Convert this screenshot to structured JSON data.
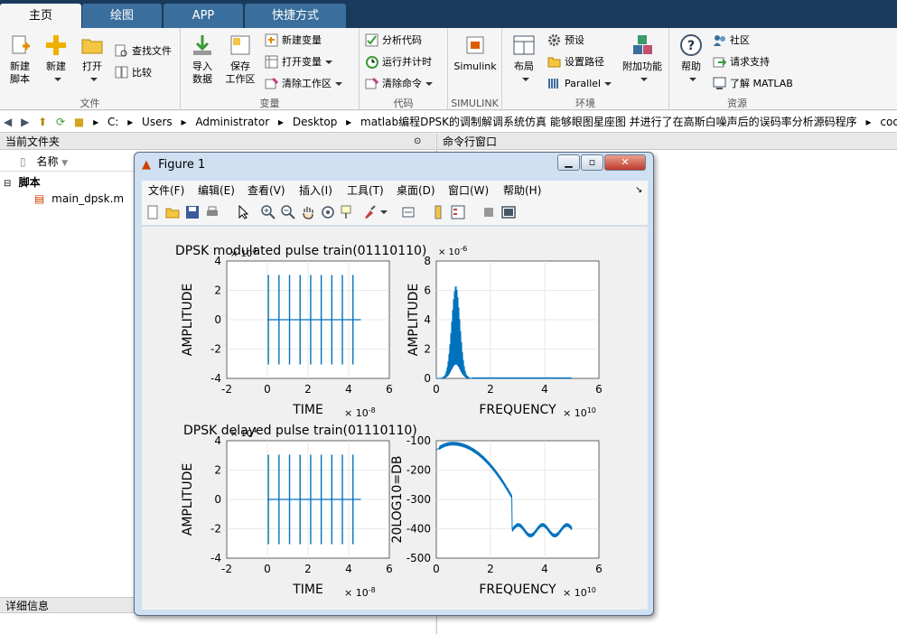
{
  "tabs": [
    "主页",
    "绘图",
    "APP",
    "快捷方式"
  ],
  "ribbon": {
    "file": {
      "label": "文件",
      "new_script": "新建\n脚本",
      "new": "新建",
      "open": "打开",
      "find_files": "查找文件",
      "compare": "比较"
    },
    "variable": {
      "label": "变量",
      "import": "导入\n数据",
      "save_workspace": "保存\n工作区",
      "new_variable": "新建变量",
      "open_variable": "打开变量",
      "clear_workspace": "清除工作区"
    },
    "code": {
      "label": "代码",
      "analyze": "分析代码",
      "run_time": "运行并计时",
      "clear_commands": "清除命令"
    },
    "simulink": {
      "label": "SIMULINK",
      "simulink": "Simulink"
    },
    "environment": {
      "label": "环境",
      "layout": "布局",
      "preferences": "预设",
      "set_path": "设置路径",
      "parallel": "Parallel",
      "addons": "附加功能"
    },
    "resources": {
      "label": "资源",
      "help": "帮助",
      "community": "社区",
      "support": "请求支持",
      "learn": "了解 MATLAB"
    }
  },
  "address": [
    "C:",
    "Users",
    "Administrator",
    "Desktop",
    "matlab编程DPSK的调制解调系统仿真 能够眼图星座图 并进行了在高斯白噪声后的误码率分析源码程序",
    "code"
  ],
  "file_browser": {
    "title": "当前文件夹",
    "column": "名称",
    "group": "脚本",
    "file": "main_dpsk.m",
    "details": "详细信息"
  },
  "command_window": {
    "title": "命令行窗口"
  },
  "figure": {
    "title": "Figure 1",
    "menu": [
      "文件(F)",
      "编辑(E)",
      "查看(V)",
      "插入(I)",
      "工具(T)",
      "桌面(D)",
      "窗口(W)",
      "帮助(H)"
    ],
    "plots": [
      {
        "title": "DPSK modulated pulse train(01110110)",
        "xlabel": "TIME",
        "ylabel": "AMPLITUDE",
        "xticks": [
          "-2",
          "0",
          "2",
          "4",
          "6"
        ],
        "yticks": [
          "4",
          "2",
          "0",
          "-2",
          "-4"
        ],
        "xexp": "× 10",
        "xexp_power": "-8",
        "yexp": "× 10",
        "yexp_power": "4"
      },
      {
        "title": "",
        "xlabel": "FREQUENCY",
        "ylabel": "AMPLITUDE",
        "xticks": [
          "0",
          "2",
          "4",
          "6"
        ],
        "yticks": [
          "8",
          "6",
          "4",
          "2",
          "0"
        ],
        "xexp": "× 10",
        "xexp_power": "10",
        "yexp": "× 10",
        "yexp_power": "-6"
      },
      {
        "title": "DPSK delayed pulse train(01110110)",
        "xlabel": "TIME",
        "ylabel": "AMPLITUDE",
        "xticks": [
          "-2",
          "0",
          "2",
          "4",
          "6"
        ],
        "yticks": [
          "4",
          "2",
          "0",
          "-2",
          "-4"
        ],
        "xexp": "× 10",
        "xexp_power": "-8",
        "yexp": "× 10",
        "yexp_power": "4"
      },
      {
        "title": "",
        "xlabel": "FREQUENCY",
        "ylabel": "20LOG10=DB",
        "xticks": [
          "0",
          "2",
          "4",
          "6"
        ],
        "yticks": [
          "-100",
          "-200",
          "-300",
          "-400",
          "-500"
        ],
        "xexp": "× 10",
        "xexp_power": "10",
        "yexp": "",
        "yexp_power": ""
      }
    ]
  },
  "colors": {
    "line": "#0072bd",
    "tabbar": "#1a3a5c",
    "active_tab": "#f5f5f5"
  }
}
